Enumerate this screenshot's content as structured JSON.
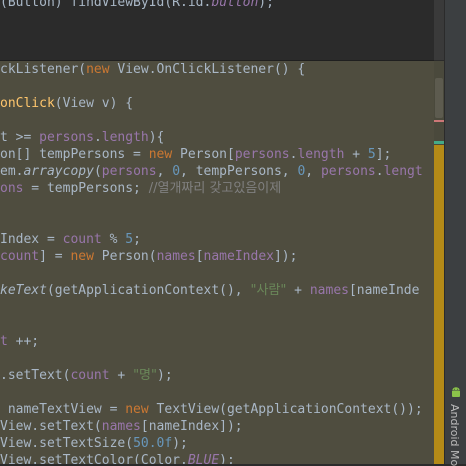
{
  "editor": {
    "lines": {
      "l0": {
        "a": "(Button) findViewById(R.id.",
        "b": "button",
        "c": ");"
      },
      "l1": {
        "a": "ckListener(",
        "b": "new",
        "c": " View.OnClickListener() {"
      },
      "l2": {
        "a": "onClick",
        "b": "(View v) {"
      },
      "l3": {
        "a": "t >= ",
        "b": "persons",
        "c": ".",
        "d": "length",
        "e": "){"
      },
      "l4": {
        "a": "on[] tempPersons = ",
        "b": "new",
        "c": " Person[",
        "d": "persons",
        "e": ".",
        "f": "length",
        "g": " + ",
        "h": "5",
        "i": "];"
      },
      "l5": {
        "a": "em.",
        "b": "arraycopy",
        "c": "(",
        "d": "persons",
        "e": ", ",
        "f": "0",
        "g": ", tempPersons, ",
        "h": "0",
        "i": ", ",
        "j": "persons",
        "k": ".",
        "l": "lengt"
      },
      "l6": {
        "a": "ons",
        "b": " = tempPersons; ",
        "c": "//열개짜리 갖고있음이제"
      },
      "l7": {
        "a": "Index = ",
        "b": "count",
        "c": " % ",
        "d": "5",
        "e": ";"
      },
      "l8": {
        "a": "count",
        "b": "] = ",
        "c": "new",
        "d": " Person(",
        "e": "names",
        "f": "[",
        "g": "nameIndex",
        "h": "]);"
      },
      "l9": {
        "a": "keText",
        "b": "(getApplicationContext(), ",
        "c": "\"사람\"",
        "d": " + ",
        "e": "names",
        "f": "[nameInde"
      },
      "l10": {
        "a": "t",
        "b": " ++;"
      },
      "l11": {
        "a": ".setText(",
        "b": "count",
        "c": " + ",
        "d": "\"명\"",
        "e": ");"
      },
      "l12": {
        "a": " nameTextView = ",
        "b": "new",
        "c": " TextView(getApplicationContext());"
      },
      "l13": {
        "a": "View.setText(",
        "b": "names",
        "c": "[nameIndex]);"
      },
      "l14": {
        "a": "View.setTextSize(",
        "b": "50.0f",
        "c": ");"
      },
      "l15": {
        "a": "View.setTextColor(Color.",
        "b": "BLUE",
        "c": ");"
      }
    }
  },
  "side_panel": {
    "label": "Android Mo",
    "icon": "android-icon"
  },
  "colors": {
    "keyword": "#cc7832",
    "field": "#9876aa",
    "method": "#ffc66d",
    "number": "#6897bb",
    "string": "#6a8759",
    "comment": "#808080",
    "text": "#a9b7c6"
  }
}
